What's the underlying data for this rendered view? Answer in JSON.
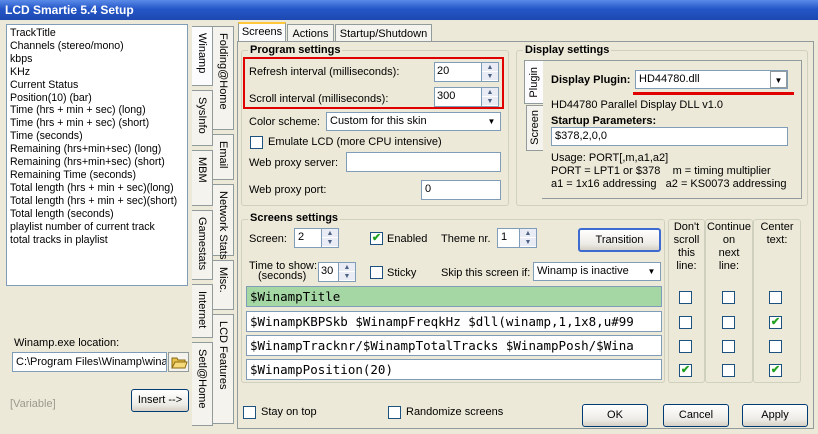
{
  "window": {
    "title": "LCD Smartie 5.4 Setup"
  },
  "left_list": {
    "items": [
      "TrackTitle",
      "Channels (stereo/mono)",
      "kbps",
      "KHz",
      "Current Status",
      "Position(10) (bar)",
      "Time (hrs + min + sec) (long)",
      "Time (hrs + min + sec) (short)",
      "Time (seconds)",
      "Remaining (hrs+min+sec) (long)",
      "Remaining (hrs+min+sec) (short)",
      "Remaining Time (seconds)",
      "Total length (hrs + min + sec)(long)",
      "Total length (hrs + min + sec)(short)",
      "Total length (seconds)",
      "playlist number of current track",
      "total tracks in playlist"
    ]
  },
  "winamp": {
    "location_label": "Winamp.exe location:",
    "location_value": "C:\\Program Files\\Winamp\\wina",
    "variable": "[Variable]",
    "insert_label": "Insert -->"
  },
  "vtabs_left": [
    "Winamp",
    "SysInfo",
    "MBM",
    "Gamestats",
    "Internet",
    "Setl@Home"
  ],
  "vtabs_right": [
    "Folding@Home",
    "Email",
    "Network Stats",
    "Misc.",
    "LCD Features"
  ],
  "tabs": [
    "Screens",
    "Actions",
    "Startup/Shutdown"
  ],
  "program_settings": {
    "title": "Program settings",
    "refresh_label": "Refresh interval (milliseconds):",
    "refresh_value": "20",
    "scroll_label": "Scroll interval (milliseconds):",
    "scroll_value": "300",
    "color_scheme_label": "Color scheme:",
    "color_scheme_value": "Custom for this skin",
    "emulate_label": "Emulate LCD  (more CPU intensive)",
    "proxy_server_label": "Web proxy server:",
    "proxy_server_value": "",
    "proxy_port_label": "Web proxy port:",
    "proxy_port_value": "0"
  },
  "display_settings": {
    "title": "Display settings",
    "tab_plugin": "Plugin",
    "tab_screen": "Screen",
    "plugin_label": "Display Plugin:",
    "plugin_value": "HD44780.dll",
    "dll_desc": "HD44780 Parallel Display DLL v1.0",
    "startup_label": "Startup Parameters:",
    "startup_value": "$378,2,0,0",
    "usage_lines": [
      "Usage: PORT[,m,a1,a2]",
      "PORT = LPT1 or $378    m = timing multiplier",
      "a1 = 1x16 addressing   a2 = KS0073 addressing"
    ]
  },
  "screens_settings": {
    "title": "Screens settings",
    "screen_label": "Screen:",
    "screen_value": "2",
    "enabled_label": "Enabled",
    "theme_label": "Theme nr.",
    "theme_value": "1",
    "transition_label": "Transition",
    "time_label": "Time to show:",
    "time_sub": "(seconds)",
    "time_value": "30",
    "sticky_label": "Sticky",
    "skip_label": "Skip this screen if:",
    "skip_value": "Winamp is inactive",
    "col_noscroll": [
      "Don't",
      "scroll",
      "this",
      "line:"
    ],
    "col_continue": [
      "Continue",
      "on",
      "next",
      "line:"
    ],
    "col_center": [
      "Center",
      "text:"
    ],
    "lines": [
      {
        "text": "$WinampTitle",
        "noscroll": false,
        "continue": false,
        "center": false
      },
      {
        "text": "$WinampKBPSkb $WinampFreqkHz $dll(winamp,1,1x8,u#99",
        "noscroll": false,
        "continue": false,
        "center": true
      },
      {
        "text": "$WinampTracknr/$WinampTotalTracks $WinampPosh/$Wina",
        "noscroll": false,
        "continue": false,
        "center": false
      },
      {
        "text": "$WinampPosition(20)",
        "noscroll": true,
        "continue": false,
        "center": true
      }
    ]
  },
  "footer": {
    "stay_on_top": "Stay on top",
    "randomize": "Randomize screens",
    "ok": "OK",
    "cancel": "Cancel",
    "apply": "Apply"
  },
  "colors": {
    "highlight_line": "#A5D7A5",
    "red_outline": "#E00000"
  }
}
